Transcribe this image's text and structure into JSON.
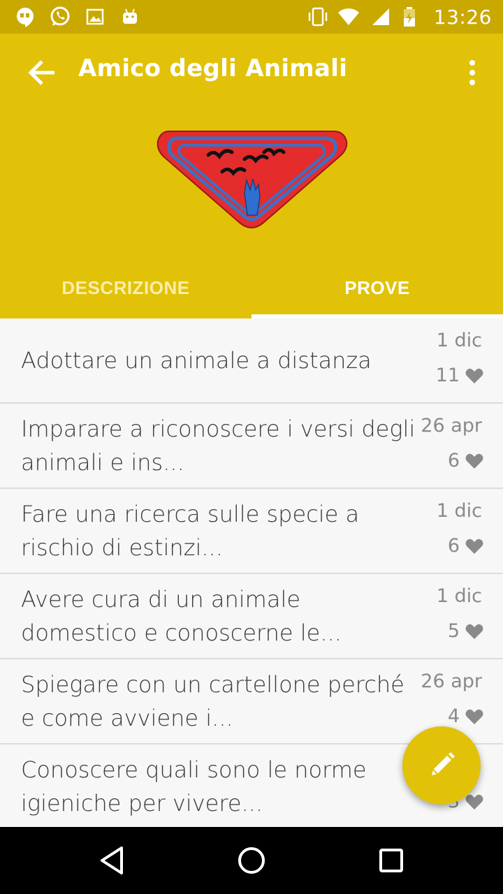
{
  "status_bar": {
    "time": "13:26",
    "left_icons": [
      "hangouts-icon",
      "whatsapp-icon",
      "image-icon",
      "android-icon"
    ],
    "right_icons": [
      "vibrate-icon",
      "wifi-icon",
      "signal-icon",
      "battery-icon"
    ]
  },
  "app_bar": {
    "title": "Amico degli Animali",
    "back_icon": "arrow-back-icon",
    "overflow_icon": "more-vert-icon",
    "header_color": "#e1c208"
  },
  "badge": {
    "description": "red triangular badge with birds and hand",
    "colors": {
      "fill": "#e42c2c",
      "stripe": "#3f6fc4",
      "birds": "#111111",
      "hand": "#2f6fd0"
    }
  },
  "tabs": [
    {
      "label": "DESCRIZIONE",
      "selected": false
    },
    {
      "label": "PROVE",
      "selected": true
    }
  ],
  "list": {
    "items": [
      {
        "text": "Adottare un animale a distanza",
        "date": "1 dic",
        "likes": "11"
      },
      {
        "text": "Imparare a riconoscere i versi degli animali e ins...",
        "date": "26 apr",
        "likes": "6"
      },
      {
        "text": "Fare una ricerca sulle specie a rischio di estinzi...",
        "date": "1 dic",
        "likes": "6"
      },
      {
        "text": "Avere cura di un animale domestico e conoscerne le...",
        "date": "1 dic",
        "likes": "5"
      },
      {
        "text": "Spiegare con un cartellone perché e come avviene i...",
        "date": "26 apr",
        "likes": "4"
      },
      {
        "text": "Conoscere quali sono le norme igieniche per vivere...",
        "date": "",
        "likes": "3"
      }
    ]
  },
  "fab": {
    "icon": "edit-pencil-icon"
  },
  "nav_bar": {
    "buttons": [
      "back-triangle-icon",
      "home-circle-icon",
      "recents-square-icon"
    ]
  }
}
